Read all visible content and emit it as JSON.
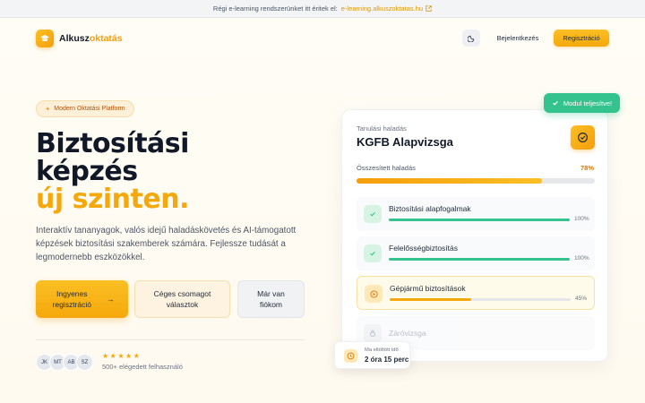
{
  "banner": {
    "text": "Régi e-learning rendszerünket itt éritek el:",
    "link_text": "e-learning.alkuszoktatas.hu",
    "icon": "external-link-icon"
  },
  "header": {
    "logo_main": "Alkusz",
    "logo_accent": "oktatás",
    "logo_icon": "graduation-cap-icon",
    "theme_icon": "moon-icon",
    "login_label": "Bejelentkezés",
    "register_label": "Regisztráció"
  },
  "hero": {
    "badge": "Modern Oktatási Platform",
    "title_line1": "Biztosítási",
    "title_line2": "képzés",
    "title_line3": "új szinten.",
    "description": "Interaktív tananyagok, valós idejű haladáskövetés és AI-támogatott képzések biztosítási szakemberek számára. Fejlessze tudását a legmodernebb eszközökkel.",
    "cta_primary": "Ingyenes regisztráció",
    "cta_primary_arrow": "→",
    "cta_secondary": "Céges csomagot választok",
    "cta_tertiary": "Már van fiókom",
    "avatars": [
      "JK",
      "MT",
      "AB",
      "SZ"
    ],
    "stars": "★★★★★",
    "users_text": "500+ elégedett felhasználó"
  },
  "card": {
    "subtitle": "Tanulási haladás",
    "title": "KGFB Alapvizsga",
    "icon": "target-icon",
    "overall_label": "Összesített haladás",
    "overall_pct_text": "78%",
    "overall_value": 78,
    "modules": [
      {
        "name": "Biztosítási alapfogalmak",
        "pct_text": "100%",
        "value": 100,
        "status": "done"
      },
      {
        "name": "Felelősségbiztosítás",
        "pct_text": "100%",
        "value": 100,
        "status": "done"
      },
      {
        "name": "Gépjármű biztosítások",
        "pct_text": "45%",
        "value": 45,
        "status": "active"
      },
      {
        "name": "Záróvizsga",
        "status": "locked"
      }
    ]
  },
  "toast": {
    "text": "Modul teljesítve!",
    "icon": "check-icon"
  },
  "timer": {
    "label": "Ma eltöltött idő",
    "value": "2 óra 15 perc",
    "icon": "clock-icon"
  },
  "colors": {
    "accent": "#f5a80b",
    "success": "#34c38f",
    "text": "#111827"
  }
}
